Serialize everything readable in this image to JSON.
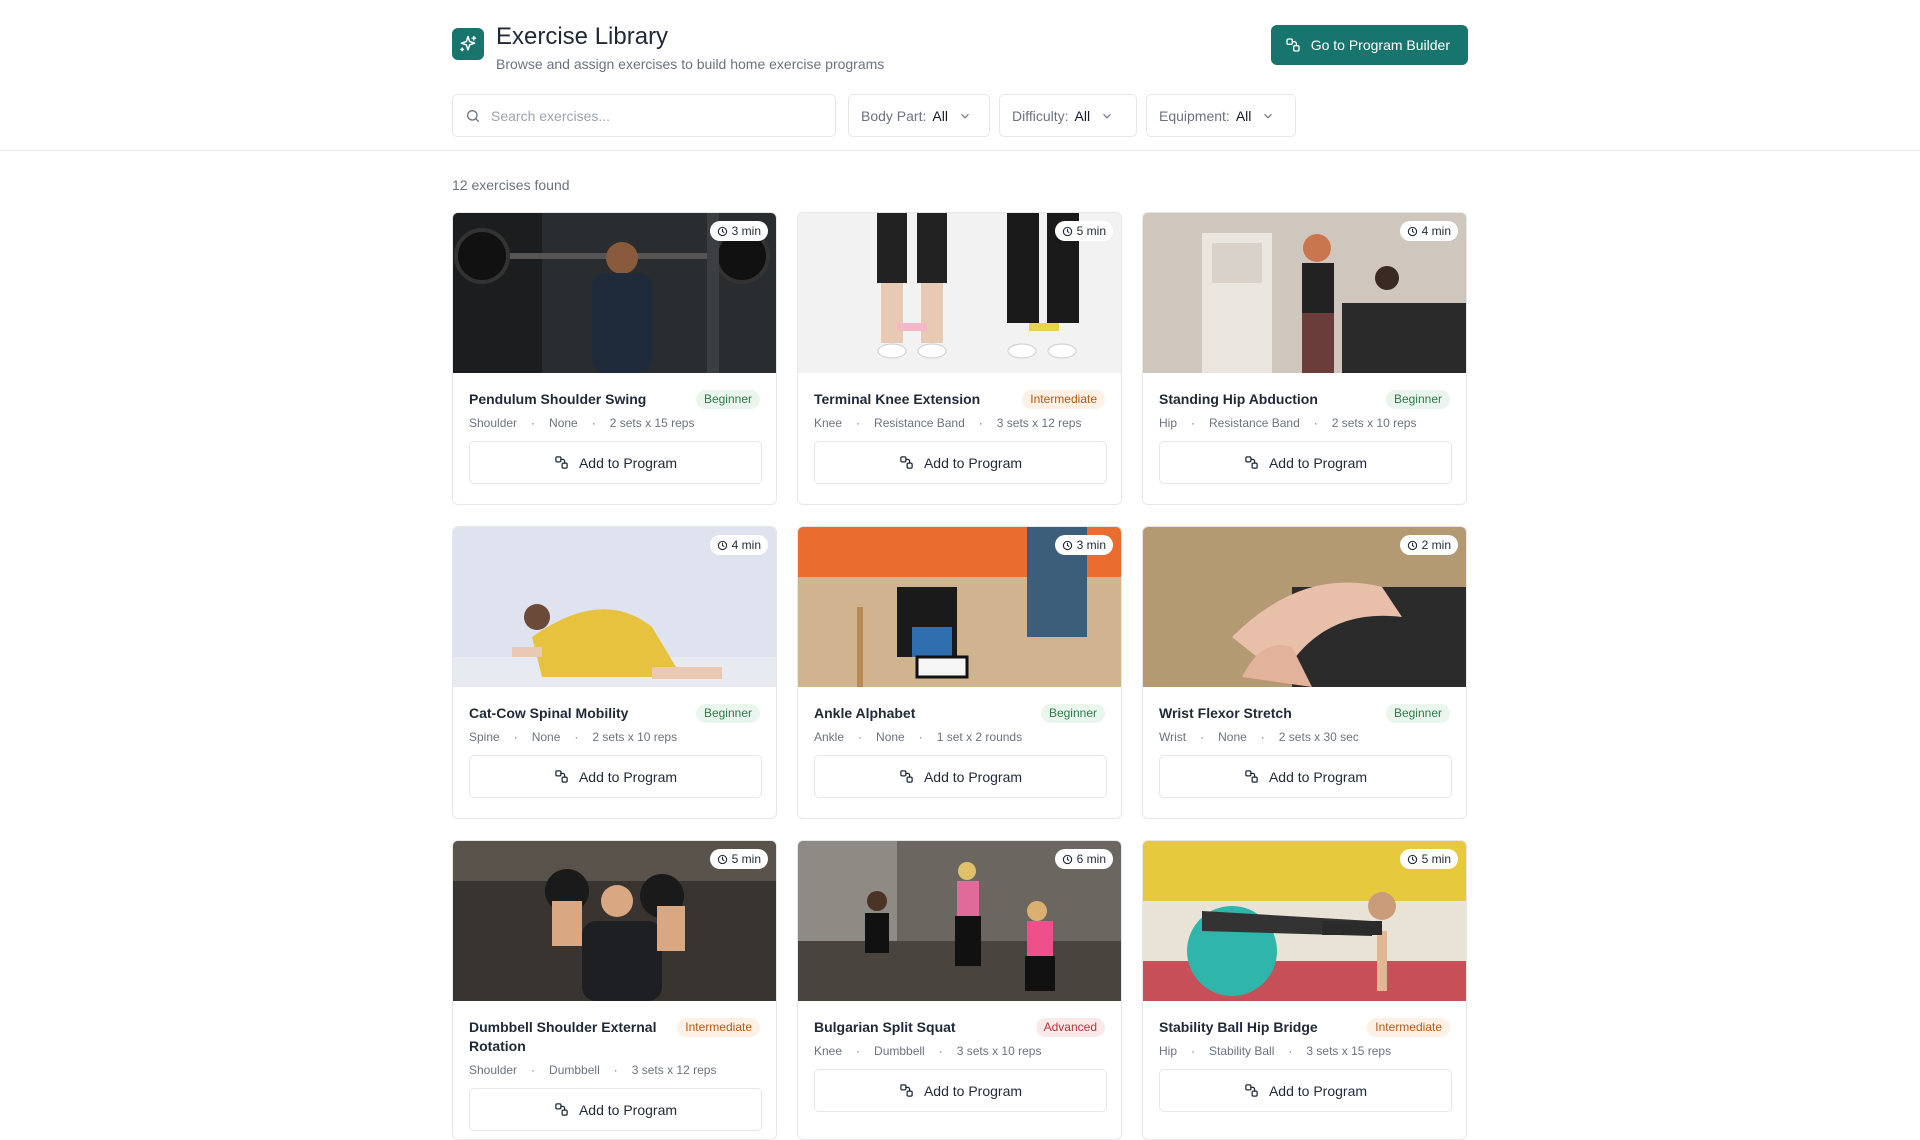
{
  "header": {
    "title": "Exercise Library",
    "subtitle": "Browse and assign exercises to build home exercise programs",
    "builder_button": "Go to Program Builder",
    "brand_color": "#17756e"
  },
  "search": {
    "placeholder": "Search exercises..."
  },
  "filters": [
    {
      "label": "Body Part:",
      "value": "All"
    },
    {
      "label": "Difficulty:",
      "value": "All"
    },
    {
      "label": "Equipment:",
      "value": "All"
    }
  ],
  "results": {
    "count_text": "12 exercises found"
  },
  "exercises": [
    {
      "name": "Pendulum Shoulder Swing",
      "difficulty": "Beginner",
      "duration": "3 min",
      "body_part": "Shoulder",
      "equipment": "None",
      "dosage": "2 sets x 15 reps",
      "add_label": "Add to Program"
    },
    {
      "name": "Terminal Knee Extension",
      "difficulty": "Intermediate",
      "duration": "5 min",
      "body_part": "Knee",
      "equipment": "Resistance Band",
      "dosage": "3 sets x 12 reps",
      "add_label": "Add to Program"
    },
    {
      "name": "Standing Hip Abduction",
      "difficulty": "Beginner",
      "duration": "4 min",
      "body_part": "Hip",
      "equipment": "Resistance Band",
      "dosage": "2 sets x 10 reps",
      "add_label": "Add to Program"
    },
    {
      "name": "Cat-Cow Spinal Mobility",
      "difficulty": "Beginner",
      "duration": "4 min",
      "body_part": "Spine",
      "equipment": "None",
      "dosage": "2 sets x 10 reps",
      "add_label": "Add to Program"
    },
    {
      "name": "Ankle Alphabet",
      "difficulty": "Beginner",
      "duration": "3 min",
      "body_part": "Ankle",
      "equipment": "None",
      "dosage": "1 set x 2 rounds",
      "add_label": "Add to Program"
    },
    {
      "name": "Wrist Flexor Stretch",
      "difficulty": "Beginner",
      "duration": "2 min",
      "body_part": "Wrist",
      "equipment": "None",
      "dosage": "2 sets x 30 sec",
      "add_label": "Add to Program"
    },
    {
      "name": "Dumbbell Shoulder External Rotation",
      "difficulty": "Intermediate",
      "duration": "5 min",
      "body_part": "Shoulder",
      "equipment": "Dumbbell",
      "dosage": "3 sets x 12 reps",
      "add_label": "Add to Program"
    },
    {
      "name": "Bulgarian Split Squat",
      "difficulty": "Advanced",
      "duration": "6 min",
      "body_part": "Knee",
      "equipment": "Dumbbell",
      "dosage": "3 sets x 10 reps",
      "add_label": "Add to Program"
    },
    {
      "name": "Stability Ball Hip Bridge",
      "difficulty": "Intermediate",
      "duration": "5 min",
      "body_part": "Hip",
      "equipment": "Stability Ball",
      "dosage": "3 sets x 15 reps",
      "add_label": "Add to Program"
    }
  ]
}
